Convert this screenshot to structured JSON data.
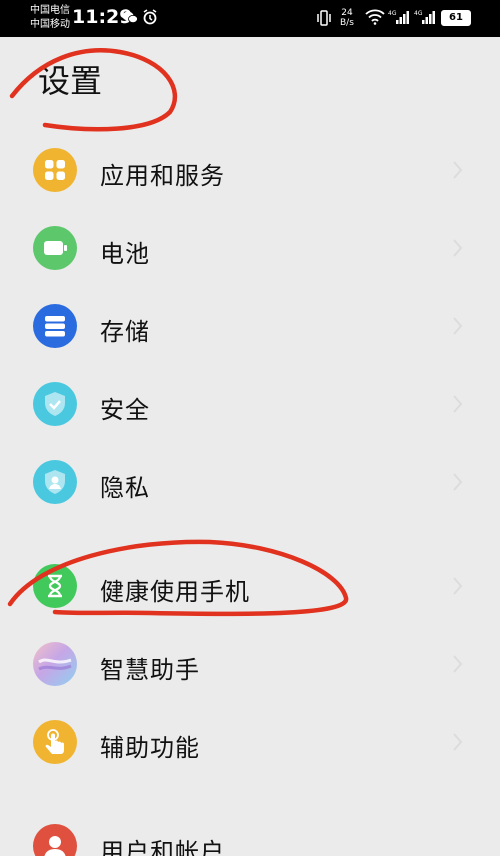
{
  "status_bar": {
    "carrier_1": "中国电信",
    "carrier_2": "中国移动",
    "time": "11:29",
    "speed_value": "24",
    "speed_unit": "B/s",
    "battery": "61"
  },
  "page_title": "设置",
  "items": [
    {
      "label": "应用和服务",
      "icon": "apps-icon",
      "color": "#f0b431"
    },
    {
      "label": "电池",
      "icon": "battery-icon",
      "color": "#5cc86b"
    },
    {
      "label": "存储",
      "icon": "storage-icon",
      "color": "#2b6be0"
    },
    {
      "label": "安全",
      "icon": "shield-check-icon",
      "color": "#49c8e0"
    },
    {
      "label": "隐私",
      "icon": "privacy-shield-icon",
      "color": "#49c8e0"
    },
    {
      "label": "健康使用手机",
      "icon": "hourglass-icon",
      "color": "#41c95b"
    },
    {
      "label": "智慧助手",
      "icon": "assistant-icon",
      "color": "#b89bd8"
    },
    {
      "label": "辅助功能",
      "icon": "hand-touch-icon",
      "color": "#f0b431"
    },
    {
      "label": "用户和帐户",
      "icon": "user-icon",
      "color": "#e0503f"
    }
  ],
  "annotation_color": "#e0321e"
}
